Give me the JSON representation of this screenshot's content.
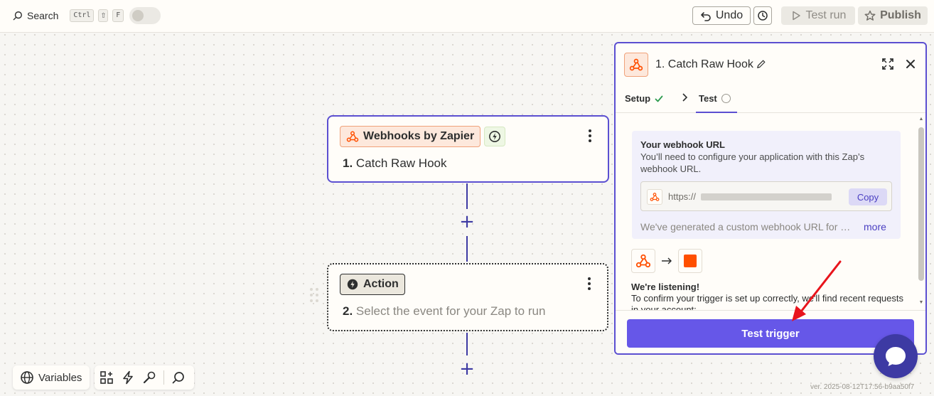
{
  "topbar": {
    "search_label": "Search",
    "shortcut_ctrl": "Ctrl",
    "shortcut_shift": "⇧",
    "shortcut_key": "F",
    "undo_label": "Undo",
    "test_run_label": "Test run",
    "publish_label": "Publish"
  },
  "steps": [
    {
      "app_name": "Webhooks by Zapier",
      "number": "1.",
      "title": "Catch Raw Hook"
    },
    {
      "app_name": "Action",
      "number": "2.",
      "title": "Select the event for your Zap to run"
    }
  ],
  "connectors": {
    "add_symbol": "+"
  },
  "bottom_toolbar": {
    "variables_label": "Variables"
  },
  "version": "ver. 2025-08-12T17:56-b9aa50f7",
  "panel": {
    "title": "1. Catch Raw Hook",
    "tabs": [
      {
        "label": "Setup",
        "status": "complete"
      },
      {
        "label": "Test",
        "status": "pending"
      }
    ],
    "webhook": {
      "heading": "Your webhook URL",
      "help": "You’ll need to configure your application with this Zap’s webhook URL.",
      "url_prefix": "https://",
      "copy_label": "Copy",
      "generated_text": "We've generated a custom webhook URL for you to send requests to.",
      "more_label": "more"
    },
    "listening": {
      "heading": "We're listening!",
      "text": "To confirm your trigger is set up correctly, we'll find recent requests in your account:"
    },
    "test_trigger_label": "Test trigger"
  },
  "colors": {
    "accent": "#5b4fd1",
    "button": "#6657e8",
    "zapier_orange": "#ff4f00",
    "annotation_red": "#e8141c",
    "chat": "#3d3aa3"
  }
}
